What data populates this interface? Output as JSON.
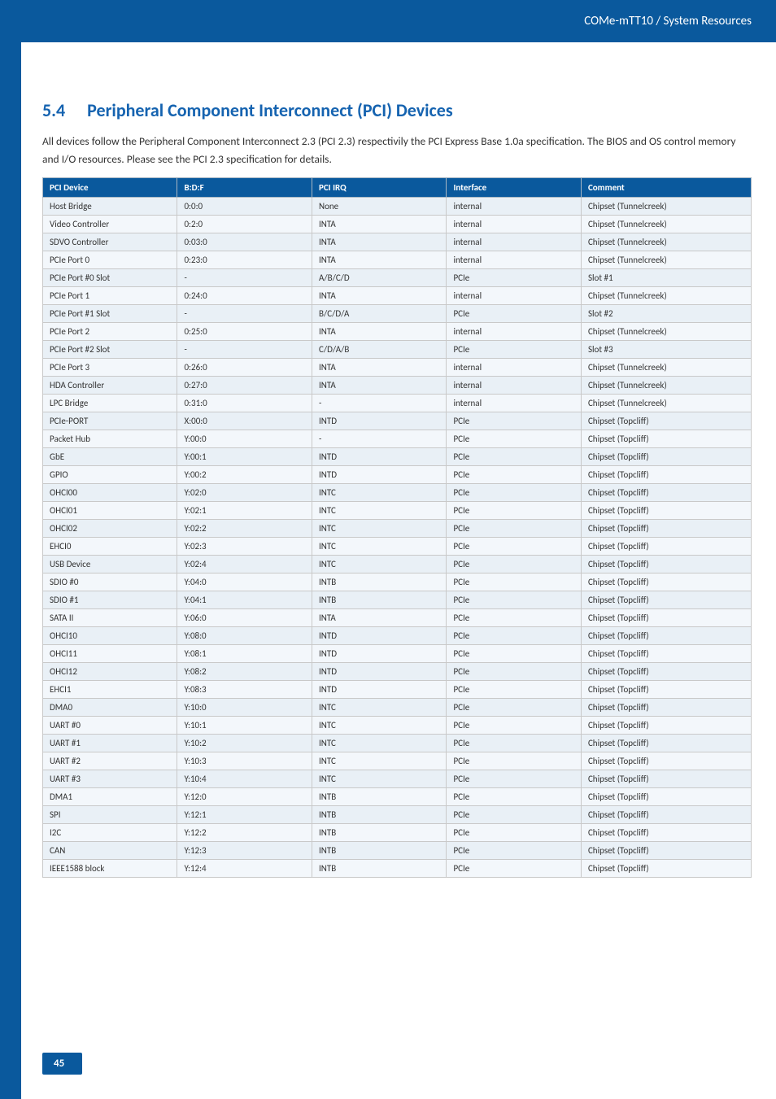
{
  "header": {
    "breadcrumb": "COMe-mTT10 / System Resources"
  },
  "section": {
    "number": "5.4",
    "title": "Peripheral Component Interconnect (PCI) Devices",
    "intro": "All devices follow the Peripheral Component Interconnect 2.3 (PCI 2.3) respectivily the PCI Express Base 1.0a specification. The BIOS and OS control memory and I/O resources. Please see the PCI 2.3 specification for details."
  },
  "table": {
    "headers": [
      "PCI Device",
      "B:D:F",
      "PCI IRQ",
      "Interface",
      "Comment"
    ],
    "rows": [
      [
        "Host Bridge",
        "0:0:0",
        "None",
        "internal",
        "Chipset (Tunnelcreek)"
      ],
      [
        "Video Controller",
        "0:2:0",
        "INTA",
        "internal",
        "Chipset (Tunnelcreek)"
      ],
      [
        "SDVO Controller",
        "0:03:0",
        "INTA",
        "internal",
        "Chipset (Tunnelcreek)"
      ],
      [
        "PCIe Port 0",
        "0:23:0",
        "INTA",
        "internal",
        "Chipset (Tunnelcreek)"
      ],
      [
        "PCIe Port #0 Slot",
        "-",
        "A/B/C/D",
        "PCIe",
        "Slot #1"
      ],
      [
        "PCIe Port 1",
        "0:24:0",
        "INTA",
        "internal",
        "Chipset (Tunnelcreek)"
      ],
      [
        "PCIe Port #1 Slot",
        "-",
        "B/C/D/A",
        "PCIe",
        "Slot #2"
      ],
      [
        "PCIe Port 2",
        "0:25:0",
        "INTA",
        "internal",
        "Chipset (Tunnelcreek)"
      ],
      [
        "PCIe Port #2 Slot",
        "-",
        "C/D/A/B",
        "PCIe",
        "Slot #3"
      ],
      [
        "PCIe Port 3",
        "0:26:0",
        "INTA",
        "internal",
        "Chipset (Tunnelcreek)"
      ],
      [
        "HDA Controller",
        "0:27:0",
        "INTA",
        "internal",
        "Chipset (Tunnelcreek)"
      ],
      [
        "LPC Bridge",
        "0:31:0",
        "-",
        "internal",
        "Chipset (Tunnelcreek)"
      ],
      [
        "PCIe-PORT",
        "X:00:0",
        "INTD",
        "PCIe",
        "Chipset (Topcliff)"
      ],
      [
        "Packet Hub",
        "Y:00:0",
        "-",
        "PCIe",
        "Chipset (Topcliff)"
      ],
      [
        "GbE",
        "Y:00:1",
        "INTD",
        "PCIe",
        "Chipset (Topcliff)"
      ],
      [
        "GPIO",
        "Y:00:2",
        "INTD",
        "PCIe",
        "Chipset (Topcliff)"
      ],
      [
        "OHCI00",
        "Y:02:0",
        "INTC",
        "PCIe",
        "Chipset (Topcliff)"
      ],
      [
        "OHCI01",
        "Y:02:1",
        "INTC",
        "PCIe",
        "Chipset (Topcliff)"
      ],
      [
        "OHCI02",
        "Y:02:2",
        "INTC",
        "PCIe",
        "Chipset (Topcliff)"
      ],
      [
        "EHCI0",
        "Y:02:3",
        "INTC",
        "PCIe",
        "Chipset (Topcliff)"
      ],
      [
        "USB Device",
        "Y:02:4",
        "INTC",
        "PCIe",
        "Chipset (Topcliff)"
      ],
      [
        "SDIO #0",
        "Y:04:0",
        "INTB",
        "PCIe",
        "Chipset (Topcliff)"
      ],
      [
        "SDIO #1",
        "Y:04:1",
        "INTB",
        "PCIe",
        "Chipset (Topcliff)"
      ],
      [
        "SATA II",
        "Y:06:0",
        "INTA",
        "PCIe",
        "Chipset (Topcliff)"
      ],
      [
        "OHCI10",
        "Y:08:0",
        "INTD",
        "PCIe",
        "Chipset (Topcliff)"
      ],
      [
        "OHCI11",
        "Y:08:1",
        "INTD",
        "PCIe",
        "Chipset (Topcliff)"
      ],
      [
        "OHCI12",
        "Y:08:2",
        "INTD",
        "PCIe",
        "Chipset (Topcliff)"
      ],
      [
        "EHCI1",
        "Y:08:3",
        "INTD",
        "PCIe",
        "Chipset (Topcliff)"
      ],
      [
        "DMA0",
        "Y:10:0",
        "INTC",
        "PCIe",
        "Chipset (Topcliff)"
      ],
      [
        "UART #0",
        "Y:10:1",
        "INTC",
        "PCIe",
        "Chipset (Topcliff)"
      ],
      [
        "UART #1",
        "Y:10:2",
        "INTC",
        "PCIe",
        "Chipset (Topcliff)"
      ],
      [
        "UART #2",
        "Y:10:3",
        "INTC",
        "PCIe",
        "Chipset (Topcliff)"
      ],
      [
        "UART #3",
        "Y:10:4",
        "INTC",
        "PCIe",
        "Chipset (Topcliff)"
      ],
      [
        "DMA1",
        "Y:12:0",
        "INTB",
        "PCIe",
        "Chipset (Topcliff)"
      ],
      [
        "SPI",
        "Y:12:1",
        "INTB",
        "PCIe",
        "Chipset (Topcliff)"
      ],
      [
        "I2C",
        "Y:12:2",
        "INTB",
        "PCIe",
        "Chipset (Topcliff)"
      ],
      [
        "CAN",
        "Y:12:3",
        "INTB",
        "PCIe",
        "Chipset (Topcliff)"
      ],
      [
        "IEEE1588 block",
        "Y:12:4",
        "INTB",
        "PCIe",
        "Chipset (Topcliff)"
      ]
    ]
  },
  "footer": {
    "page_number": "45"
  }
}
